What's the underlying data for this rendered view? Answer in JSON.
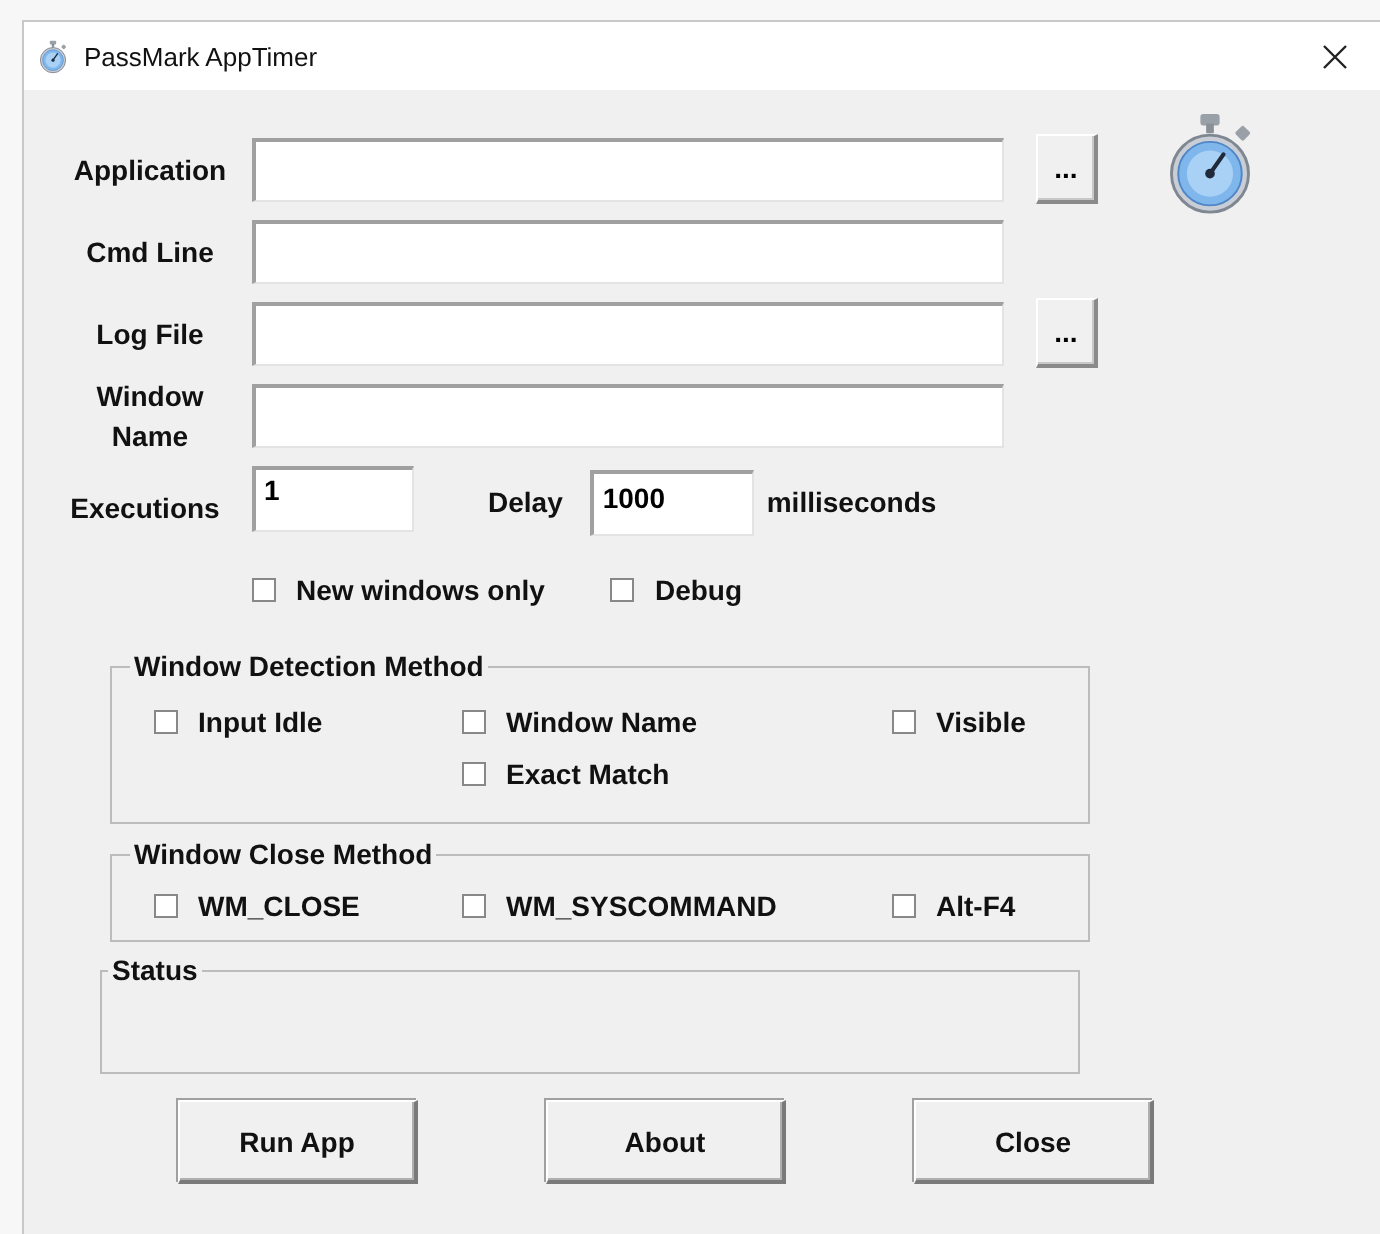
{
  "window": {
    "title": "PassMark AppTimer"
  },
  "fields": [
    {
      "label": "Application",
      "browse_button": "..."
    },
    {
      "label": "Cmd Line"
    },
    {
      "label": "Log File",
      "browse_button": "..."
    },
    {
      "label": "Window Name"
    }
  ],
  "executions": {
    "label": "Executions",
    "value": "1"
  },
  "delay": {
    "label": "Delay",
    "value": "1000",
    "unit": "milliseconds"
  },
  "options": [
    {
      "label": "New windows only",
      "checked": false
    },
    {
      "label": "Debug",
      "checked": false
    }
  ],
  "detection_group": {
    "title": "Window Detection Method",
    "options": [
      {
        "label": "Input Idle",
        "checked": false
      },
      {
        "label": "Window Name",
        "checked": false
      },
      {
        "label": "Visible",
        "checked": false
      },
      {
        "label": "Exact Match",
        "checked": false
      }
    ]
  },
  "close_group": {
    "title": "Window Close Method",
    "options": [
      {
        "label": "WM_CLOSE",
        "checked": false
      },
      {
        "label": "WM_SYSCOMMAND",
        "checked": false
      },
      {
        "label": "Alt-F4",
        "checked": false
      }
    ]
  },
  "status_group": {
    "title": "Status"
  },
  "buttons": [
    {
      "label": "Run App"
    },
    {
      "label": "About"
    },
    {
      "label": "Close"
    }
  ]
}
